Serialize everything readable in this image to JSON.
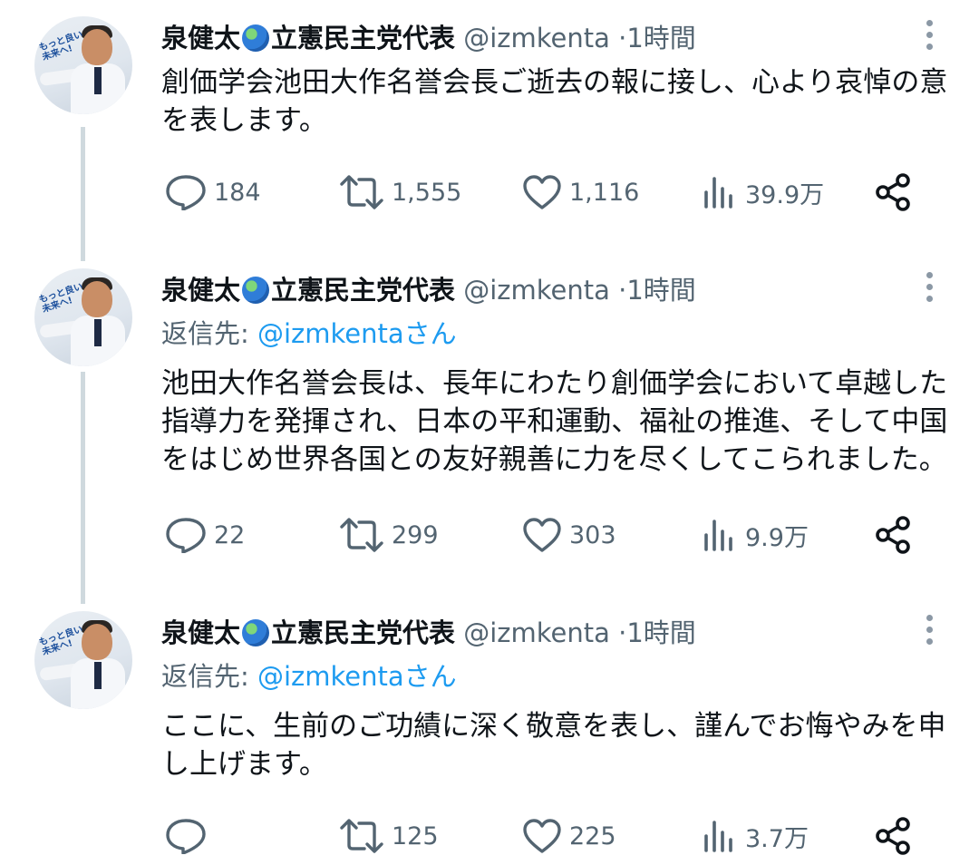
{
  "tweets": [
    {
      "name": "泉健太",
      "name_suffix": "立憲民主党代表",
      "handle": "@izmkenta",
      "separator": "·",
      "time": "1時間",
      "reply_label": "",
      "reply_handle": "",
      "text": "創価学会池田大作名誉会長ご逝去の報に接し、心より哀悼の意を表します。",
      "replies": "184",
      "retweets": "1,555",
      "likes": "1,116",
      "views": "39.9万"
    },
    {
      "name": "泉健太",
      "name_suffix": "立憲民主党代表",
      "handle": "@izmkenta",
      "separator": "·",
      "time": "1時間",
      "reply_label": "返信先: ",
      "reply_handle": "@izmkentaさん",
      "text": "池田大作名誉会長は、長年にわたり創価学会において卓越した指導力を発揮され、日本の平和運動、福祉の推進、そして中国をはじめ世界各国との友好親善に力を尽くしてこられました。",
      "replies": "22",
      "retweets": "299",
      "likes": "303",
      "views": "9.9万"
    },
    {
      "name": "泉健太",
      "name_suffix": "立憲民主党代表",
      "handle": "@izmkenta",
      "separator": "·",
      "time": "1時間",
      "reply_label": "返信先: ",
      "reply_handle": "@izmkentaさん",
      "text": "ここに、生前のご功績に深く敬意を表し、謹んでお悔やみを申し上げます。",
      "replies": "",
      "retweets": "125",
      "likes": "225",
      "views": "3.7万"
    }
  ],
  "avatar_slogan": "もっと良い未来へ!",
  "icons": {
    "reply": "reply-icon",
    "retweet": "retweet-icon",
    "like": "heart-icon",
    "views": "views-icon",
    "share": "share-icon",
    "more": "more-icon",
    "globe": "globe-emoji"
  },
  "colors": {
    "text": "#0f1419",
    "muted": "#536471",
    "link": "#1d9bf0",
    "thread_line": "#cfd9de"
  }
}
